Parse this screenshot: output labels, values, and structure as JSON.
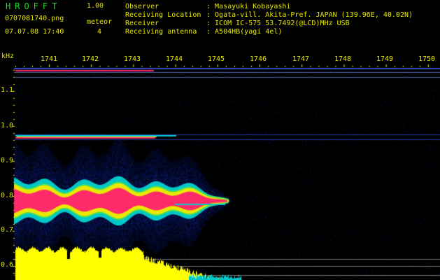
{
  "header": {
    "app_name": "HROFFT",
    "version": "1.00",
    "filename": "0707081740.png",
    "datetime": "07.07.08 17:40",
    "meteor_label": "meteor",
    "meteor_count": "4",
    "info": [
      {
        "label": "Observer",
        "value": ": Masayuki Kobayashi"
      },
      {
        "label": "Receiving Location",
        "value": ": Ogata-vill. Akita-Pref. JAPAN (139.96E, 40.02N)"
      },
      {
        "label": "Receiver",
        "value": ": ICOM IC-575 53.7492(@LCD)MHz USB"
      },
      {
        "label": "Receiving antenna",
        "value": ": A504HB(yagi 4el)"
      }
    ]
  },
  "axes": {
    "y_unit": "kHz",
    "x_ticks": [
      "1741",
      "1742",
      "1743",
      "1744",
      "1745",
      "1746",
      "1747",
      "1748",
      "1749",
      "1750"
    ],
    "y_ticks": [
      "1.1",
      "1.0",
      "0.9",
      "0.8",
      "0.7",
      "0.6"
    ]
  },
  "colors": {
    "background": "#000000",
    "axis_text": "#e8e800",
    "title": "#22dd22",
    "signal_peak": "#ff2a6a",
    "signal_mid": "#e8e800",
    "signal_low": "#00c8c8",
    "noise": "#1030c0",
    "level_meter": "#ffff00"
  }
}
